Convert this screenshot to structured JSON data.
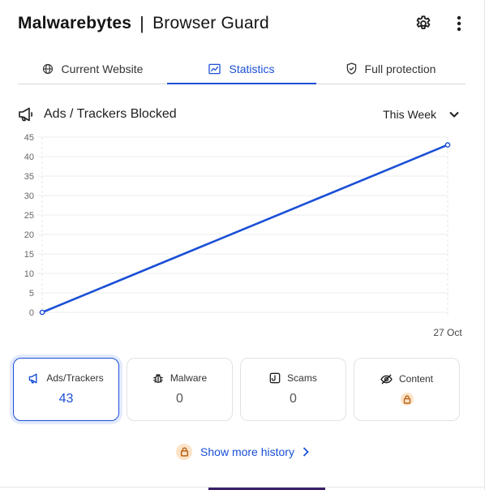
{
  "header": {
    "brand_m": "M",
    "brand_rest": "alwarebytes",
    "brand_sep": "|",
    "product": "Browser Guard",
    "settings_icon": "gear-icon",
    "menu_icon": "kebab-menu-icon"
  },
  "tabs": [
    {
      "label": "Current Website",
      "icon": "globe-icon",
      "active": false
    },
    {
      "label": "Statistics",
      "icon": "chart-icon",
      "active": true
    },
    {
      "label": "Full protection",
      "icon": "shield-icon",
      "active": false
    }
  ],
  "section": {
    "title": "Ads / Trackers Blocked",
    "icon": "megaphone-icon",
    "range": "This Week"
  },
  "chart_data": {
    "type": "line",
    "x": [
      "",
      "27 Oct"
    ],
    "series": [
      {
        "values": [
          0,
          43
        ]
      }
    ],
    "y_ticks": [
      0,
      5,
      10,
      15,
      20,
      25,
      30,
      35,
      40,
      45
    ],
    "ylim": [
      0,
      45
    ],
    "grid": true,
    "color": "#1a4fd6"
  },
  "cards": [
    {
      "label": "Ads/Trackers",
      "icon": "megaphone-icon",
      "value": "43",
      "active": true
    },
    {
      "label": "Malware",
      "icon": "bug-icon",
      "value": "0",
      "active": false
    },
    {
      "label": "Scams",
      "icon": "hook-icon",
      "value": "0",
      "active": false
    },
    {
      "label": "Content",
      "icon": "eye-off-icon",
      "value": "",
      "locked": true,
      "active": false
    }
  ],
  "more_link": {
    "label": "Show more history",
    "icon": "lock-icon"
  },
  "colors": {
    "accent": "#1a4fd6",
    "lock_badge": "#fde3c7",
    "lock_glyph": "#b8651c"
  }
}
